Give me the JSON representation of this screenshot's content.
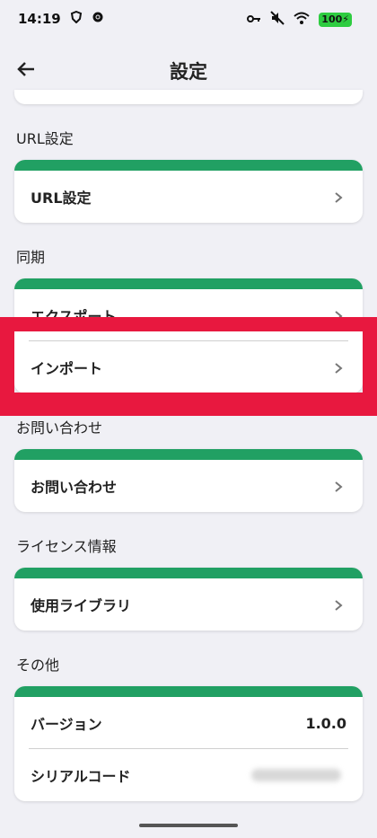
{
  "status_bar": {
    "time": "14:19",
    "battery": "100",
    "icons_left": [
      "shield-icon",
      "gear-icon"
    ],
    "icons_right": [
      "key-icon",
      "mute-icon",
      "wifi-icon",
      "battery-icon"
    ]
  },
  "app_bar": {
    "title": "設定",
    "back_icon": "arrow-left-icon"
  },
  "sections": {
    "url": {
      "label": "URL設定",
      "items": [
        {
          "label": "URL設定"
        }
      ]
    },
    "sync": {
      "label": "同期",
      "items": [
        {
          "label": "エクスポート"
        },
        {
          "label": "インポート"
        }
      ]
    },
    "contact": {
      "label": "お問い合わせ",
      "items": [
        {
          "label": "お問い合わせ"
        }
      ]
    },
    "license": {
      "label": "ライセンス情報",
      "items": [
        {
          "label": "使用ライブラリ"
        }
      ]
    },
    "other": {
      "label": "その他",
      "items": [
        {
          "label": "バージョン",
          "value": "1.0.0"
        },
        {
          "label": "シリアルコード"
        }
      ]
    }
  },
  "colors": {
    "accent": "#21a063",
    "highlight": "#e8183f",
    "background": "#f0f0f5"
  }
}
